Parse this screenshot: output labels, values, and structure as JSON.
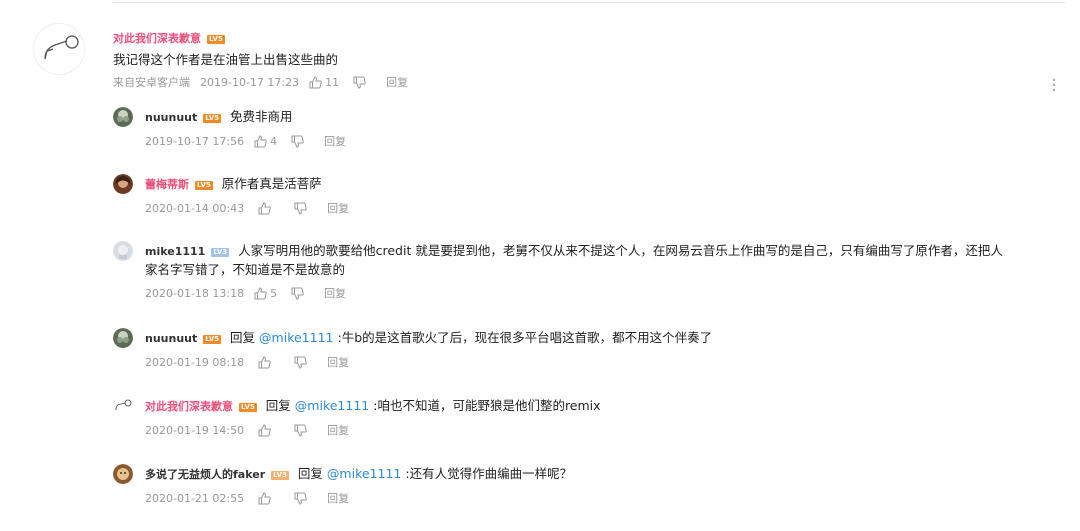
{
  "main_comment": {
    "user": "对此我们深表歉意",
    "level": "LV5",
    "text": "我记得这个作者是在油管上出售这些曲的",
    "source": "来自安卓客户端",
    "time": "2019-10-17 17:23",
    "likes": "11",
    "reply_label": "回复"
  },
  "replies": [
    {
      "user": "nuunuut",
      "level": "LV5",
      "prefix": "",
      "mention": "",
      "text": "免费非商用",
      "time": "2019-10-17 17:56",
      "likes": "4",
      "reply_label": "回复"
    },
    {
      "user": "蕾梅蒂斯",
      "level": "LV5",
      "prefix": "",
      "mention": "",
      "text": "原作者真是活菩萨",
      "time": "2020-01-14 00:43",
      "likes": "",
      "reply_label": "回复"
    },
    {
      "user": "mike1111",
      "level": "LV3",
      "prefix": "",
      "mention": "",
      "text": "人家写明用他的歌要给他credit 就是要提到他，老舅不仅从来不提这个人，在网易云音乐上作曲写的是自己，只有编曲写了原作者，还把人",
      "text2": "家名字写错了，不知道是不是故意的",
      "time": "2020-01-18 13:18",
      "likes": "5",
      "reply_label": "回复"
    },
    {
      "user": "nuunuut",
      "level": "LV5",
      "prefix": "回复",
      "mention": "@mike1111",
      "text": ":牛b的是这首歌火了后，现在很多平台唱这首歌，都不用这个伴奏了",
      "time": "2020-01-19 08:18",
      "likes": "",
      "reply_label": "回复"
    },
    {
      "user": "对此我们深表歉意",
      "level": "LV5",
      "prefix": "回复",
      "mention": "@mike1111",
      "text": ":咱也不知道，可能野狼是他们整的remix",
      "time": "2020-01-19 14:50",
      "likes": "",
      "reply_label": "回复"
    },
    {
      "user": "多说了无益烦人的faker",
      "level": "LV3",
      "prefix": "回复",
      "mention": "@mike1111",
      "text": ":还有人觉得作曲编曲一样呢？",
      "time": "2020-01-21 02:55",
      "likes": "",
      "reply_label": "回复"
    }
  ],
  "colors": {
    "accent_pink": "#eb4f7a",
    "mention_blue": "#2d8ad6",
    "meta_gray": "#999999"
  },
  "icons": [
    "thumbs-up-icon",
    "thumbs-down-icon",
    "more-vertical-icon"
  ]
}
